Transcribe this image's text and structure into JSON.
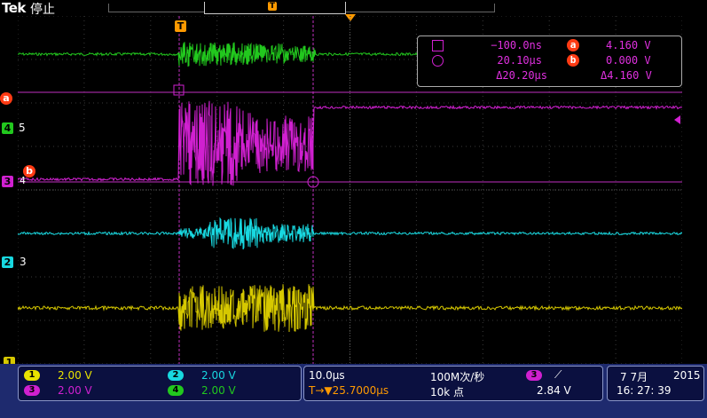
{
  "header": {
    "brand": "Tek",
    "run_state": "停止"
  },
  "colors": {
    "ch1": "#d6c800",
    "ch2": "#18d8e0",
    "ch3": "#d020d0",
    "ch4": "#22c81e",
    "cursor": "#ff3b14",
    "trigger": "#ff9a00"
  },
  "markers": {
    "trigger_top": "T",
    "record_pos": "T",
    "cursor_a": "a",
    "cursor_b": "b",
    "ch4_badge": "4",
    "ch4_scale": "5",
    "ch3_badge": "3",
    "ch3_scale": "4",
    "ch2_badge": "2",
    "ch2_scale": "3",
    "ch1_badge": "1"
  },
  "readout": {
    "time_a": "−100.0ns",
    "volt_a": "4.160 V",
    "time_b": "20.10µs",
    "volt_b": "0.000 V",
    "delta_t": "Δ20.20µs",
    "delta_v": "Δ4.160 V",
    "icon_a": "a",
    "icon_b": "b"
  },
  "channels": [
    {
      "num": "1",
      "scale": "2.00 V"
    },
    {
      "num": "3",
      "scale": "2.00 V"
    },
    {
      "num": "2",
      "scale": "2.00 V"
    },
    {
      "num": "4",
      "scale": "2.00 V"
    }
  ],
  "timebase": {
    "horizontal": "10.0µs",
    "trigger_pos": "T→▼25.7000µs",
    "sample_rate": "100M次/秒",
    "record_length": "10k 点"
  },
  "trigger": {
    "source": "3",
    "slope": "⟋",
    "level": "2.84 V"
  },
  "datetime": {
    "date": "7 7月",
    "year": "2015",
    "time": "16: 27: 39"
  }
}
